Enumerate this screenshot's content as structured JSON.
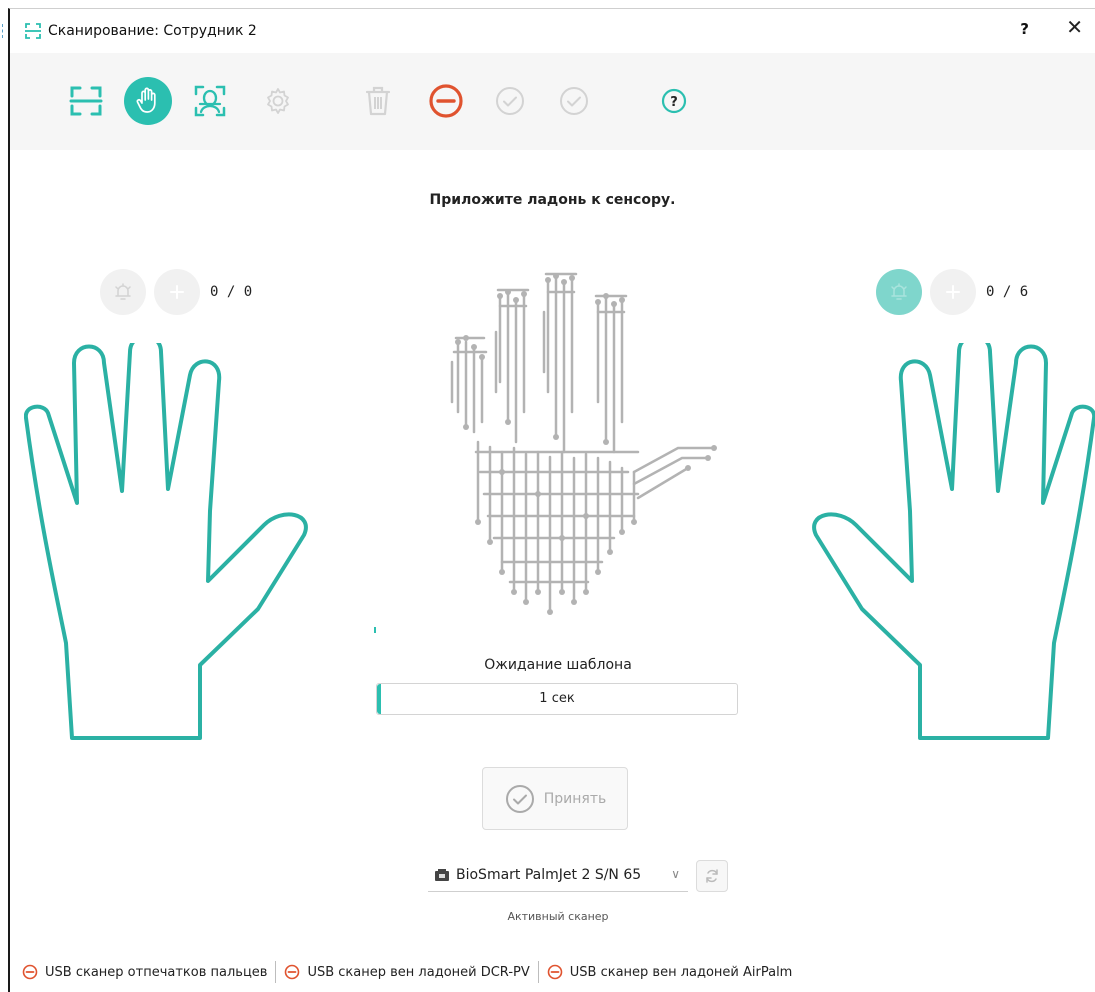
{
  "window": {
    "title": "Сканирование: Сотрудник 2",
    "help_label": "?",
    "close_label": "✕"
  },
  "toolbar": {
    "buttons": [
      {
        "name": "fingerprint-scan-icon",
        "state": "enabled"
      },
      {
        "name": "palm-scan-icon",
        "state": "active"
      },
      {
        "name": "face-scan-icon",
        "state": "enabled"
      },
      {
        "name": "settings-icon",
        "state": "disabled"
      },
      {
        "name": "delete-icon",
        "state": "disabled"
      },
      {
        "name": "cancel-icon",
        "state": "enabled"
      },
      {
        "name": "confirm-icon",
        "state": "disabled"
      },
      {
        "name": "confirm-all-icon",
        "state": "disabled"
      },
      {
        "name": "help-icon",
        "state": "enabled"
      }
    ]
  },
  "main": {
    "instruction": "Приложите ладонь к сенсору.",
    "left_hand": {
      "count": "0 / 0"
    },
    "right_hand": {
      "count": "0 / 6"
    },
    "waiting_label": "Ожидание шаблона",
    "progress_text": "1 сек",
    "progress_fraction": 0.01,
    "accept_label": "Принять",
    "scanner_value": "BioSmart PalmJet 2 S/N 65",
    "scanner_caption": "Активный сканер"
  },
  "status": {
    "items": [
      {
        "label": "USB сканер отпечатков пальцев"
      },
      {
        "label": "USB сканер вен ладоней DCR-PV"
      },
      {
        "label": "USB сканер вен ладоней AirPalm"
      }
    ]
  },
  "colors": {
    "accent": "#2bbfb0",
    "accent_light": "#7fd6cc",
    "danger": "#e0532f",
    "disabled": "#d3d3d3",
    "toolbar_bg": "#f6f6f6",
    "circuit": "#b3b3b3"
  }
}
